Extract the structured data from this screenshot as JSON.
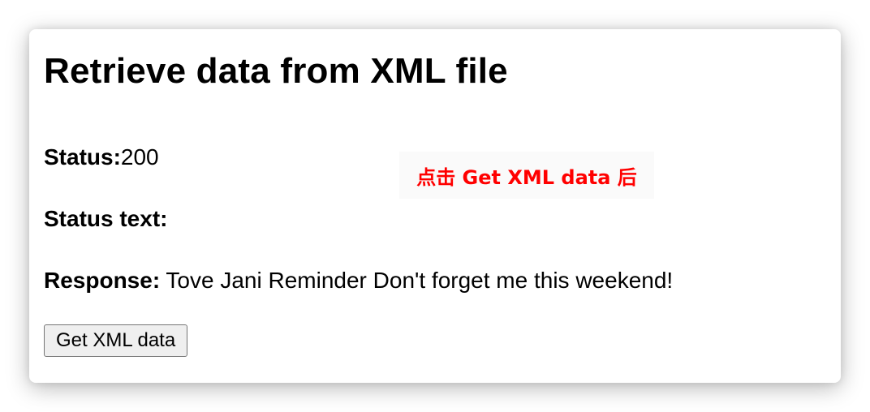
{
  "page": {
    "title": "Retrieve data from XML file"
  },
  "status": {
    "label": "Status:",
    "value": "200"
  },
  "status_text": {
    "label": "Status text:",
    "value": ""
  },
  "response": {
    "label": "Response:",
    "value": " Tove Jani Reminder Don't forget me this weekend!"
  },
  "button": {
    "label": "Get XML data"
  },
  "annotation": {
    "text": "点击 Get XML data 后",
    "color": "#ff0000"
  }
}
